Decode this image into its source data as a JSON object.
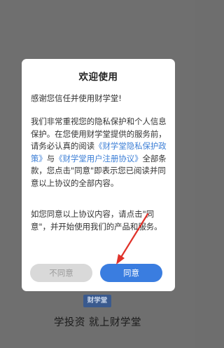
{
  "dialog": {
    "title": "欢迎使用",
    "greeting": "感谢您信任并使用财学堂!",
    "intro_text": "我们非常重视您的隐私保护和个人信息保护。在您使用财学堂提供的服务前，请务必认真的阅读",
    "privacy_link": "《财学堂隐私保护政策》",
    "conjunction": "与",
    "user_agreement_link": "《财学堂用户注册协议》",
    "after_links_text": "全部条款，您点击\"同意\"即表示您已阅读并同意以上协议的全部内容。",
    "agree_note": "如您同意以上协议内容，请点击\"同意\"，并开始使用我们的产品和服务。",
    "disagree_label": "不同意",
    "agree_label": "同意"
  },
  "footer": {
    "logo_text": "财学堂",
    "tagline": "学投资 就上财学堂"
  },
  "colors": {
    "accent": "#3a7de0",
    "link": "#3d7fd6",
    "arrow": "#e0322a"
  }
}
